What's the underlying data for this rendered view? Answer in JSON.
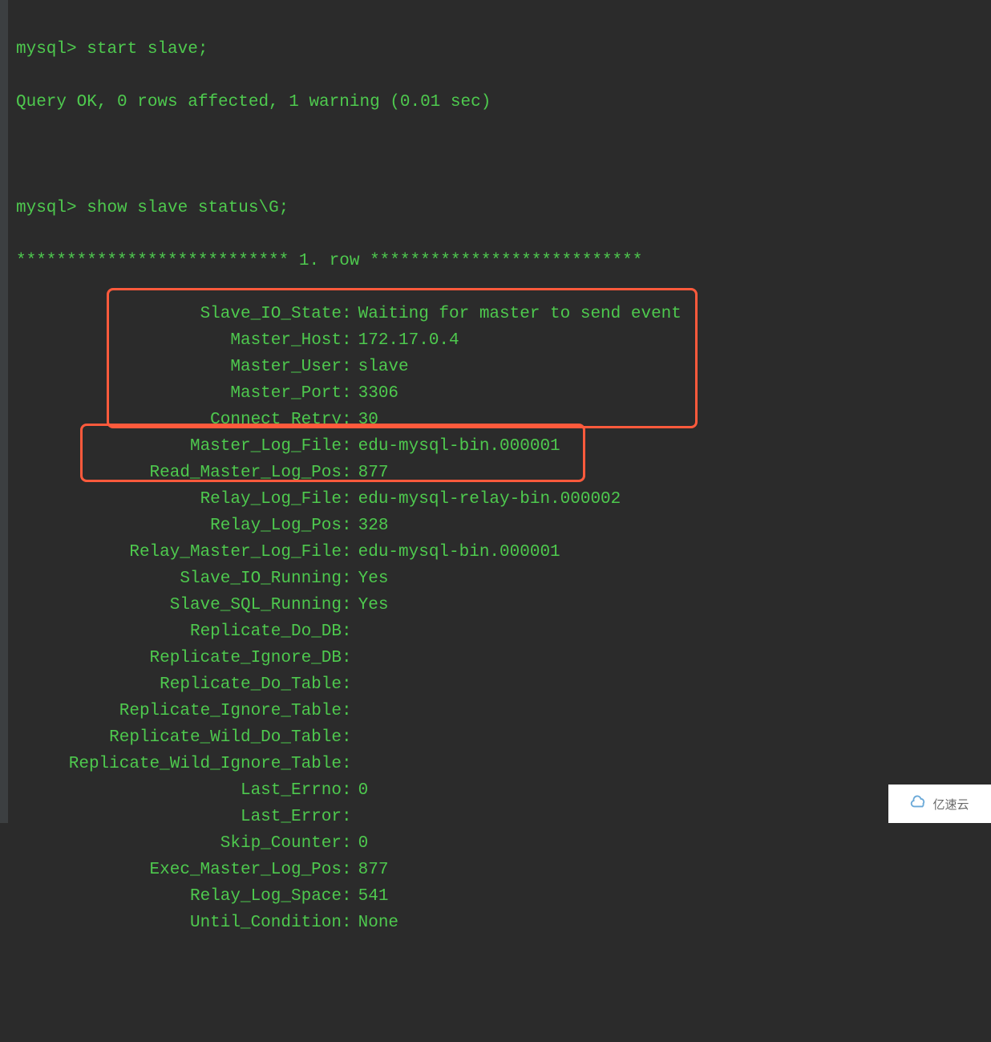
{
  "prompt": "mysql>",
  "cmd1": "start slave;",
  "result1": "Query OK, 0 rows affected, 1 warning (0.01 sec)",
  "cmd2": "show slave status\\G;",
  "row_header": "*************************** 1. row ***************************",
  "status": [
    {
      "label": "Slave_IO_State",
      "value": "Waiting for master to send event"
    },
    {
      "label": "Master_Host",
      "value": "172.17.0.4"
    },
    {
      "label": "Master_User",
      "value": "slave"
    },
    {
      "label": "Master_Port",
      "value": "3306"
    },
    {
      "label": "Connect_Retry",
      "value": "30"
    },
    {
      "label": "Master_Log_File",
      "value": "edu-mysql-bin.000001"
    },
    {
      "label": "Read_Master_Log_Pos",
      "value": "877"
    },
    {
      "label": "Relay_Log_File",
      "value": "edu-mysql-relay-bin.000002"
    },
    {
      "label": "Relay_Log_Pos",
      "value": "328"
    },
    {
      "label": "Relay_Master_Log_File",
      "value": "edu-mysql-bin.000001"
    },
    {
      "label": "Slave_IO_Running",
      "value": "Yes"
    },
    {
      "label": "Slave_SQL_Running",
      "value": "Yes"
    },
    {
      "label": "Replicate_Do_DB",
      "value": ""
    },
    {
      "label": "Replicate_Ignore_DB",
      "value": ""
    },
    {
      "label": "Replicate_Do_Table",
      "value": ""
    },
    {
      "label": "Replicate_Ignore_Table",
      "value": ""
    },
    {
      "label": "Replicate_Wild_Do_Table",
      "value": ""
    },
    {
      "label": "Replicate_Wild_Ignore_Table",
      "value": ""
    },
    {
      "label": "Last_Errno",
      "value": "0"
    },
    {
      "label": "Last_Error",
      "value": ""
    },
    {
      "label": "Skip_Counter",
      "value": "0"
    },
    {
      "label": "Exec_Master_Log_Pos",
      "value": "877"
    },
    {
      "label": "Relay_Log_Space",
      "value": "541"
    },
    {
      "label": "Until_Condition",
      "value": "None"
    }
  ],
  "watermark": "亿速云"
}
